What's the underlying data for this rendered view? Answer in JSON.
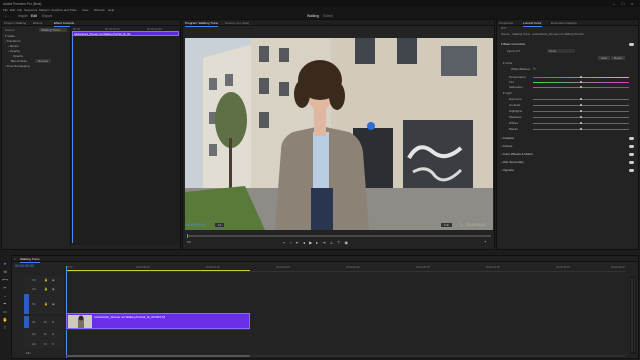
{
  "titlebar": {
    "title": "Adobe Premiere Pro (Beta)"
  },
  "menu": [
    "File",
    "Edit",
    "Clip",
    "Sequence",
    "Markers",
    "Graphics and Titles",
    "View",
    "Window",
    "Help"
  ],
  "workspaces": {
    "items": [
      "Home",
      "Import",
      "Edit",
      "Export"
    ],
    "active": "Edit"
  },
  "header_center": {
    "title": "Walking",
    "subtitle": "Edited"
  },
  "left_panel": {
    "tabs": [
      "Project: Walking",
      "Effects",
      "Effect Controls"
    ],
    "active_tab": "Effect Controls",
    "source_label": "Source",
    "clip_label": "Walking Trans...",
    "timecode_start": "00:00",
    "sections": [
      {
        "label": "Video",
        "indent": 0
      },
      {
        "label": "Transform",
        "indent": 0
      },
      {
        "label": "Motion",
        "indent": 1
      },
      {
        "label": "Opacity",
        "indent": 1
      },
      {
        "label": "Opacity",
        "indent": 2
      },
      {
        "label": "Blend Mode",
        "indent": 2,
        "value": "Normal"
      },
      {
        "label": "Time Remapping",
        "indent": 0
      }
    ],
    "ruler_labels": [
      "00:00",
      "00:00:05:00",
      "00:00:10:00"
    ],
    "clip_in_panel": "AdobeStock_Woman not Walking Portrait_4k_60...",
    "bottom_timecode": "00:00:00:00"
  },
  "program": {
    "tabs": [
      "Program: Walking Trans",
      "Source: (no clips)"
    ],
    "active_tab": "Program: Walking Trans",
    "timecode": "00:00:00:00",
    "fit": "Fit",
    "quality": "Full",
    "duration": "00:00:10:00"
  },
  "right_panel": {
    "tabs": [
      "Properties",
      "Lumetri Color",
      "Essential Graphics",
      "Text"
    ],
    "active_tab": "Lumetri Color",
    "source_line": "Source · Walking Trans · AdobeStock_Woman not Walking Portrait",
    "basic_correction": "Basic Correction",
    "input_lut_label": "Input LUT",
    "input_lut_value": "None",
    "auto_label": "Auto",
    "reset_label": "Reset",
    "color_label": "Color",
    "white_balance_label": "White Balance",
    "color_sliders": [
      {
        "label": "Temperature",
        "value": 0
      },
      {
        "label": "Tint",
        "value": 0
      },
      {
        "label": "Saturation",
        "value": 100
      }
    ],
    "light_label": "Light",
    "light_sliders": [
      {
        "label": "Exposure",
        "value": 0
      },
      {
        "label": "Contrast",
        "value": 0
      },
      {
        "label": "Highlights",
        "value": 0
      },
      {
        "label": "Shadows",
        "value": 0
      },
      {
        "label": "Whites",
        "value": 0
      },
      {
        "label": "Blacks",
        "value": 0
      }
    ],
    "sections": [
      "Creative",
      "Curves",
      "Color Wheels & Match",
      "HSL Secondary",
      "Vignette"
    ]
  },
  "timeline": {
    "sequence_tab": "Walking Trans",
    "timecode": "00:00:00:00",
    "ruler": [
      "00:00",
      "00:00:05:00",
      "00:00:10:00",
      "00:00:15:00",
      "00:00:20:00",
      "00:00:25:00",
      "00:00:30:00",
      "00:00:35:00",
      "00:00:40:00"
    ],
    "video_tracks": [
      "V3",
      "V2",
      "V1"
    ],
    "audio_tracks": [
      "A1",
      "A2",
      "A3"
    ],
    "clip_label": "AdobeStock_Woman not Walking Portrait_4k_60.MP4 [V]",
    "audio_clip_label": "Mix"
  },
  "colors": {
    "accent_blue": "#4a8cff",
    "clip_purple": "#5b2bd9",
    "panel_bg": "#232323"
  }
}
